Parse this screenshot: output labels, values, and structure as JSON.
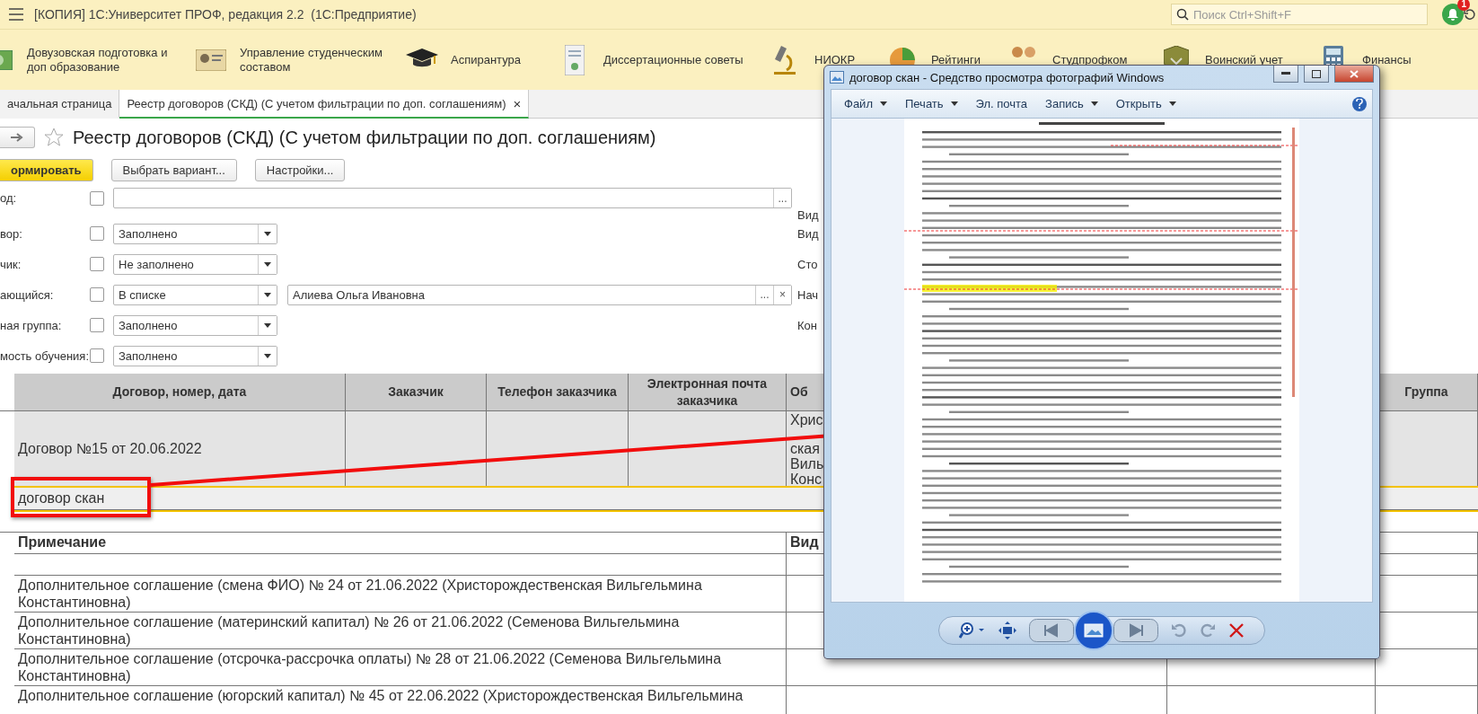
{
  "app_bar": {
    "title": "[КОПИЯ] 1С:Университет ПРОФ, редакция 2.2  (1С:Предприятие)",
    "search": {
      "placeholder": "Поиск Ctrl+Shift+F"
    },
    "notification_count": "1"
  },
  "sections": [
    {
      "label": "Довузовская подготовка и доп образование",
      "kind": "banknote"
    },
    {
      "label": "Управление студенческим составом",
      "kind": "id-card"
    },
    {
      "label": "Аспирантура",
      "kind": "graduation-cap"
    },
    {
      "label": "Диссертационные советы",
      "kind": "certificate"
    },
    {
      "label": "НИОКР",
      "kind": "microscope"
    },
    {
      "label": "Рейтинги",
      "kind": "pie-chart"
    },
    {
      "label": "Студпрофком",
      "kind": "people"
    },
    {
      "label": "Воинский учет",
      "kind": "shield"
    },
    {
      "label": "Финансы",
      "kind": "calculator"
    }
  ],
  "tabs": [
    {
      "label": "ачальная страница",
      "selected": false
    },
    {
      "label": "Реестр договоров (СКД) (С учетом фильтрации по доп. соглашениям)",
      "selected": true,
      "close": "×"
    }
  ],
  "report": {
    "title": "Реестр договоров (СКД) (С учетом фильтрации по доп. соглашениям)",
    "buttons": [
      {
        "label": "ормировать",
        "kind": "primary"
      },
      {
        "label": "Выбрать вариант...",
        "kind": "default"
      },
      {
        "label": "Настройки...",
        "kind": "default"
      }
    ],
    "filters": [
      {
        "label": "од:",
        "checked": false,
        "kind": "picker",
        "picker": "...",
        "side_label": "Вид"
      },
      {
        "label": "вор:",
        "checked": false,
        "kind": "select",
        "condition": "Заполнено",
        "side_label": "Вид"
      },
      {
        "label": "чик:",
        "checked": false,
        "kind": "select",
        "condition": "Не заполнено",
        "side_label": "Сто"
      },
      {
        "label": "ающийся:",
        "checked": false,
        "kind": "select-list",
        "condition": "В списке",
        "value": "Алиева Ольга Ивановна",
        "picker": "...",
        "clear": "×",
        "side_label": "Нач"
      },
      {
        "label": "ная группа:",
        "checked": false,
        "kind": "select",
        "condition": "Заполнено",
        "side_label": "Кон"
      },
      {
        "label": "мость обучения:",
        "checked": false,
        "kind": "select",
        "condition": "Заполнено"
      }
    ]
  },
  "table": {
    "columns": [
      "Договор, номер, дата",
      "Заказчик",
      "Телефон заказчика",
      "Электронная почта заказчика",
      "Об",
      "Группа"
    ],
    "contract_row": {
      "contract": "Договор №15 от 20.06.2022",
      "column_5_lines": [
        "Хрис",
        "ская",
        "Виль",
        "Конс"
      ]
    },
    "file_row": "договор скан"
  },
  "notes": {
    "columns": [
      "Примечание",
      "Вид"
    ],
    "rows": [
      "Дополнительное соглашение (смена ФИО) № 24 от 21.06.2022 (Христорождественская Вильгельмина Константиновна)",
      "Дополнительное соглашение (материнский капитал) № 26 от 21.06.2022 (Семенова Вильгельмина Константиновна)",
      "Дополнительное соглашение (отсрочка-рассрочка оплаты) № 28 от 21.06.2022 (Семенова Вильгельмина Константиновна)",
      "Дополнительное соглашение (югорский капитал) № 45 от 22.06.2022 (Христорождественская Вильгельмина"
    ]
  },
  "viewer": {
    "title": "договор скан - Средство просмотра фотографий Windows",
    "menu": [
      {
        "label": "Файл",
        "dropdown": true
      },
      {
        "label": "Печать",
        "dropdown": true
      },
      {
        "label": "Эл. почта",
        "dropdown": false
      },
      {
        "label": "Запись",
        "dropdown": true
      },
      {
        "label": "Открыть",
        "dropdown": true
      }
    ]
  }
}
